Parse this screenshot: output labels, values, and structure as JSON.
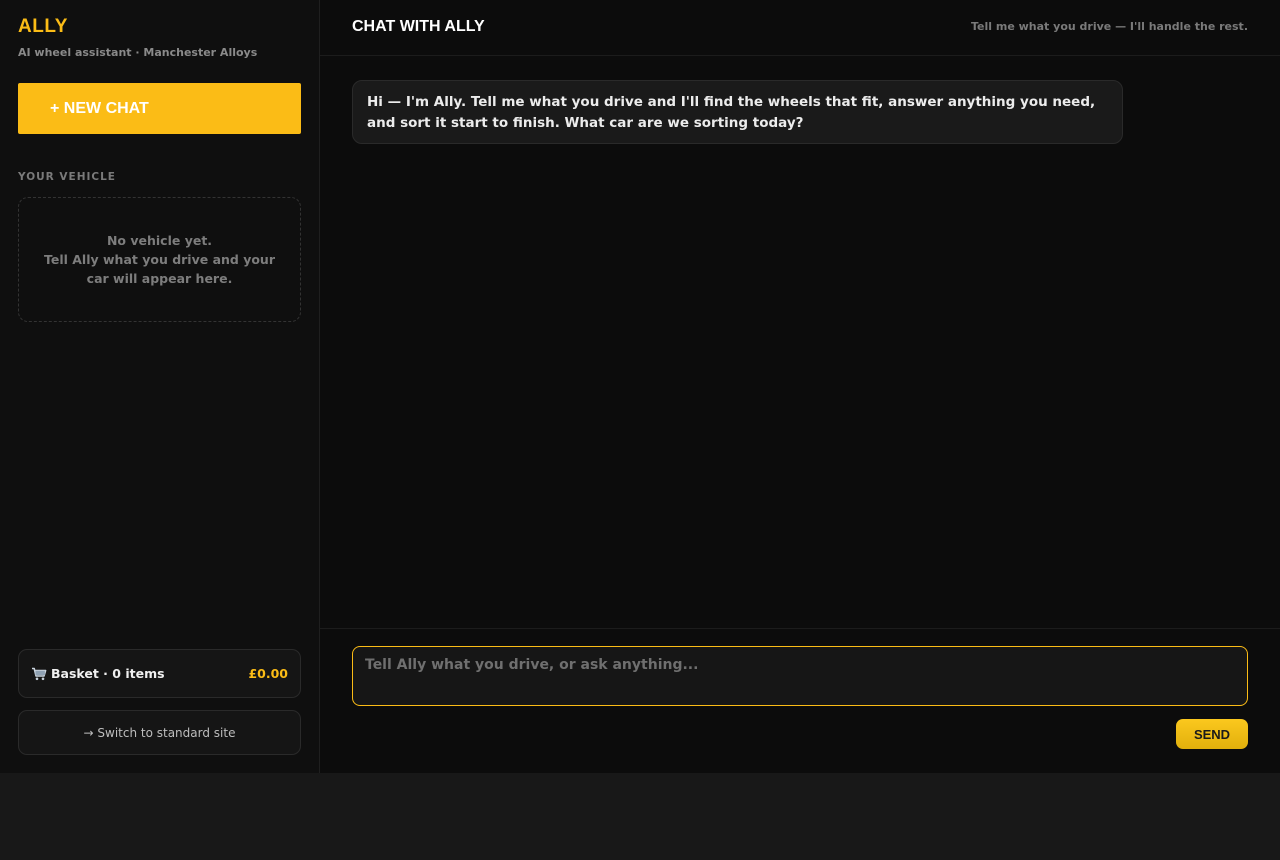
{
  "sidebar": {
    "brand": "ALLY",
    "brand_sub": "AI wheel assistant · Manchester Alloys",
    "new_chat_label": "+ NEW CHAT",
    "vehicle_section_label": "YOUR VEHICLE",
    "vehicle_empty_line1": "No vehicle yet.",
    "vehicle_empty_line2": "Tell Ally what you drive and your car will appear here.",
    "basket_label": "Basket · 0 items",
    "basket_icon": "cart-icon",
    "basket_total": "£0.00",
    "switch_site_label": "→ Switch to standard site"
  },
  "header": {
    "title": "CHAT WITH ALLY",
    "tagline": "Tell me what you drive — I'll handle the rest."
  },
  "messages": [
    {
      "sender": "Ally",
      "text": "Hi — I'm Ally. Tell me what you drive and I'll find the wheels that fit, answer anything you need, and sort it start to finish. What car are we sorting today?"
    }
  ],
  "composer": {
    "placeholder": "Tell Ally what you drive, or ask anything...",
    "value": "",
    "send_label": "SEND"
  },
  "colors": {
    "accent": "#fbbc16",
    "background": "#0c0c0c",
    "sidebar": "#0f0f0f"
  }
}
